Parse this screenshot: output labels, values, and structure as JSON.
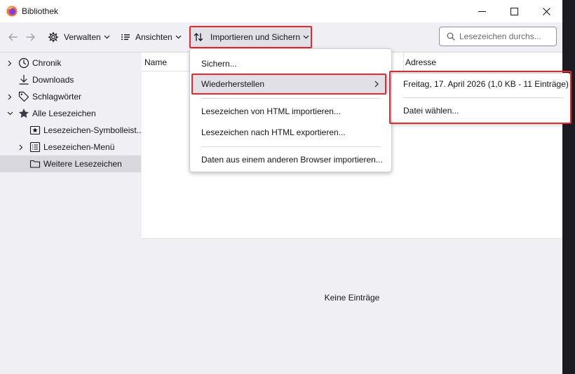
{
  "window": {
    "title": "Bibliothek"
  },
  "toolbar": {
    "organize_label": "Verwalten",
    "views_label": "Ansichten",
    "import_label": "Importieren und Sichern",
    "search_placeholder": "Lesezeichen durchs..."
  },
  "sidebar": {
    "items": [
      {
        "label": "Chronik",
        "icon": "clock-icon"
      },
      {
        "label": "Downloads",
        "icon": "download-icon"
      },
      {
        "label": "Schlagwörter",
        "icon": "tag-icon"
      },
      {
        "label": "Alle Lesezeichen",
        "icon": "star-icon"
      },
      {
        "label": "Lesezeichen-Symbolleist...",
        "icon": "bookmarks-toolbar-icon"
      },
      {
        "label": "Lesezeichen-Menü",
        "icon": "bookmarks-menu-icon"
      },
      {
        "label": "Weitere Lesezeichen",
        "icon": "folder-icon"
      }
    ]
  },
  "table": {
    "columns": [
      "Name",
      "Adresse"
    ],
    "empty_text": "Keine Einträge"
  },
  "import_menu": {
    "items": [
      {
        "label": "Sichern..."
      },
      {
        "label": "Wiederherstellen"
      },
      {
        "label": "Lesezeichen von HTML importieren..."
      },
      {
        "label": "Lesezeichen nach HTML exportieren..."
      },
      {
        "label": "Daten aus einem anderen Browser importieren..."
      }
    ]
  },
  "restore_menu": {
    "items": [
      {
        "label": "Freitag, 17. April 2026 (1,0 KB - 11 Einträge)"
      },
      {
        "label": "Datei wählen..."
      }
    ]
  },
  "colors": {
    "highlight": "#e8262b",
    "accent": "#ff7139"
  }
}
